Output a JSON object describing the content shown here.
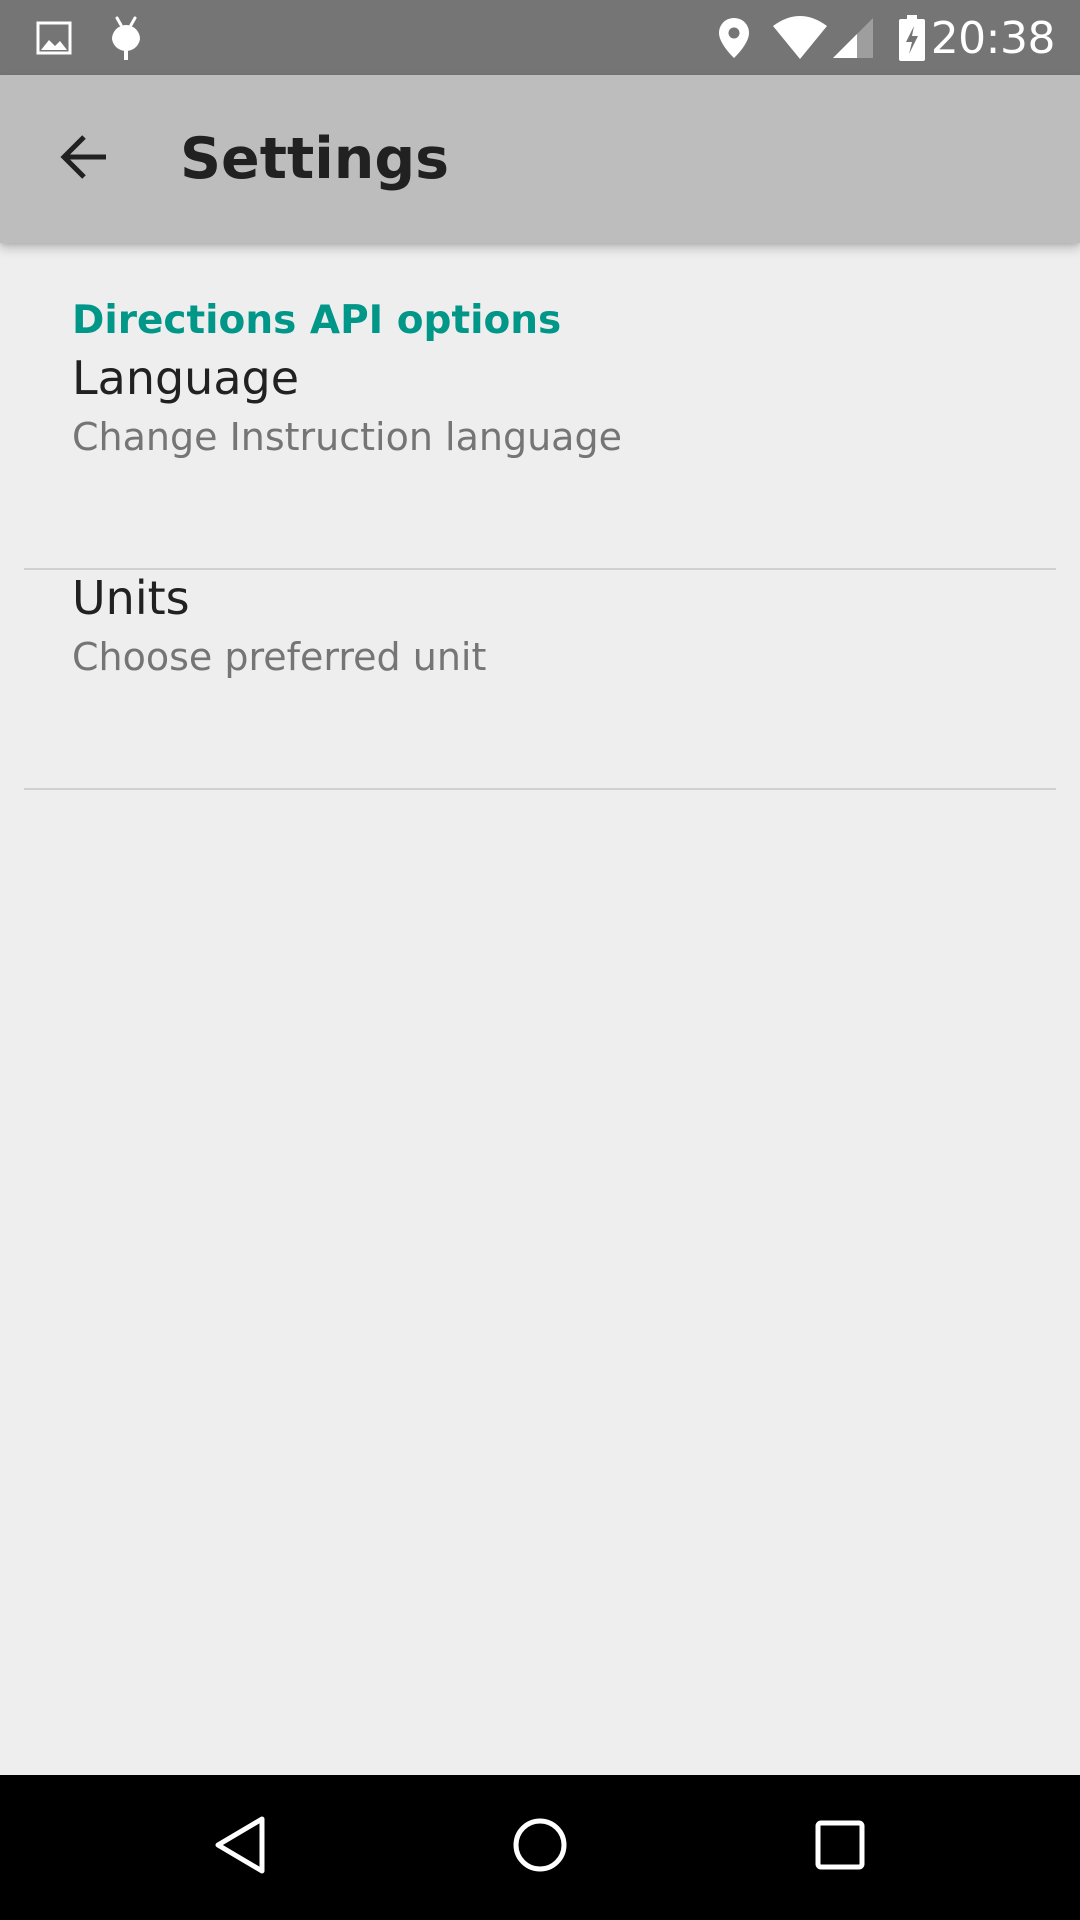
{
  "status_bar": {
    "time": "20:38",
    "left_icons": [
      "image-icon",
      "android-debug-icon"
    ],
    "right_icons": [
      "location-icon",
      "wifi-icon",
      "cell-signal-icon",
      "battery-charging-icon"
    ]
  },
  "app_bar": {
    "title": "Settings",
    "back_icon": "arrow-back-icon",
    "background": "#bdbdbd"
  },
  "preferences": {
    "category_title": "Directions API options",
    "category_color": "#009688",
    "items": [
      {
        "title": "Language",
        "summary": "Change Instruction language"
      },
      {
        "title": "Units",
        "summary": "Choose preferred unit"
      }
    ]
  },
  "nav_bar": {
    "buttons": [
      "back-triangle-icon",
      "home-circle-icon",
      "recents-square-icon"
    ]
  }
}
